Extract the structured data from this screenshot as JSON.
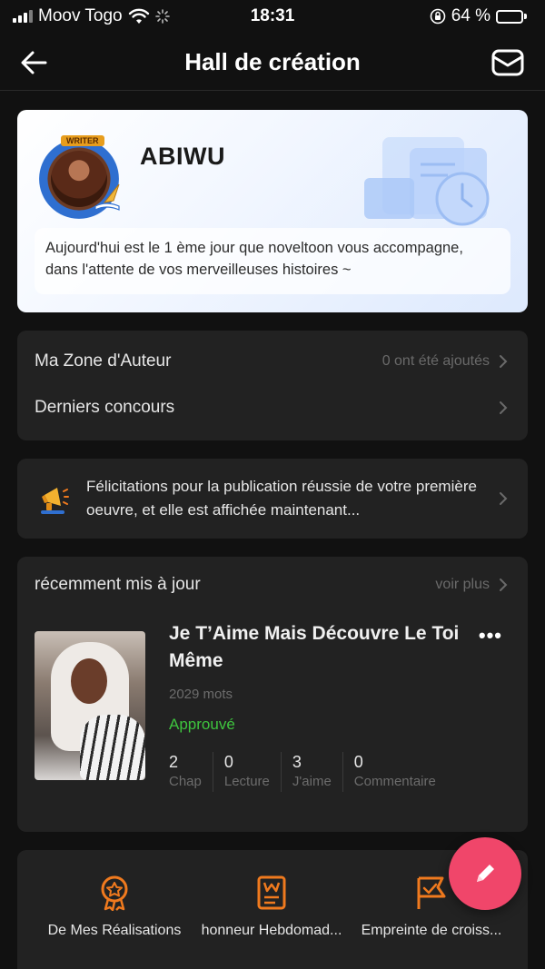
{
  "status_bar": {
    "carrier": "Moov Togo",
    "time": "18:31",
    "battery_percent": "64 %",
    "battery_level": 0.64
  },
  "header": {
    "title": "Hall de création"
  },
  "profile": {
    "badge": "WRITER",
    "username": "ABIWU",
    "greeting": "Aujourd'hui est le 1 ème jour que noveltoon vous accompagne, dans l'attente de vos merveilleuses histoires ~"
  },
  "menu": {
    "author_zone_label": "Ma Zone d'Auteur",
    "author_zone_meta": "0 ont été ajoutés",
    "contests_label": "Derniers concours"
  },
  "notification": {
    "text": "Félicitations pour la publication réussie de votre première oeuvre, et elle est affichée maintenant..."
  },
  "recent": {
    "section_title": "récemment mis à jour",
    "see_more": "voir plus",
    "work": {
      "title": "Je T’Aime Mais Découvre Le Toi Même",
      "word_count": "2029 mots",
      "status": "Approuvé",
      "stats": [
        {
          "value": "2",
          "label": "Chap"
        },
        {
          "value": "0",
          "label": "Lecture"
        },
        {
          "value": "3",
          "label": "J'aime"
        },
        {
          "value": "0",
          "label": "Commentaire"
        }
      ]
    }
  },
  "bottom": {
    "items": [
      {
        "label": "De Mes Réalisations"
      },
      {
        "label": "honneur Hebdomad..."
      },
      {
        "label": "Empreinte de croiss..."
      }
    ]
  },
  "colors": {
    "accent": "#f0466a",
    "approved": "#3ec43e",
    "icon_orange": "#f07a1e"
  }
}
